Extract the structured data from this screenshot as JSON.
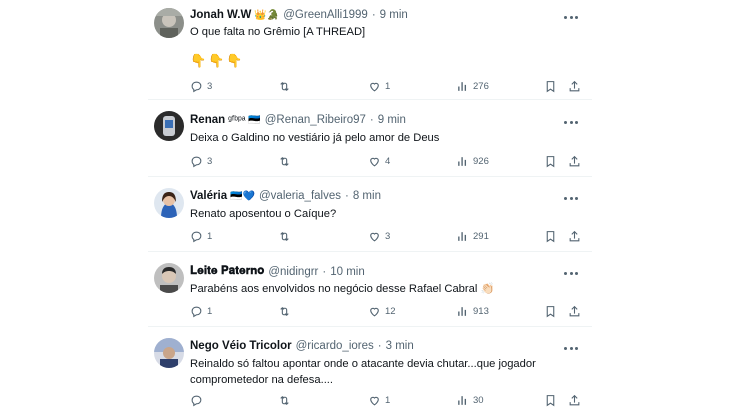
{
  "tweets": [
    {
      "name": "Jonah W.W",
      "badges": "👑🐊",
      "handle": "@GreenAlli1999",
      "time": "9 min",
      "text": "O que falta no Grêmio [A THREAD]",
      "extra": "👇👇👇",
      "replies": "3",
      "retweets": "",
      "likes": "1",
      "views": "276"
    },
    {
      "name": "Renan",
      "badges": "ᵍᶠᵇᵖᵃ 🇪🇪",
      "handle": "@Renan_Ribeiro97",
      "time": "9 min",
      "text": "Deixa o Galdino no vestiário já pelo amor de Deus",
      "replies": "3",
      "retweets": "",
      "likes": "4",
      "views": "926"
    },
    {
      "name": "Valéria",
      "badges": "🇪🇪💙",
      "handle": "@valeria_falves",
      "time": "8 min",
      "text": "Renato aposentou o Caíque?",
      "replies": "1",
      "retweets": "",
      "likes": "3",
      "views": "291"
    },
    {
      "name": "𝐋𝐞𝐢𝐭𝐞 𝐏𝐚𝐭𝐞𝐫𝐧𝐨",
      "badges": "",
      "handle": "@nidingrr",
      "time": "10 min",
      "text": "Parabéns aos envolvidos no negócio desse Rafael Cabral 👏🏻",
      "replies": "1",
      "retweets": "",
      "likes": "12",
      "views": "913"
    },
    {
      "name": "Nego Véio Tricolor",
      "badges": "",
      "handle": "@ricardo_iores",
      "time": "3 min",
      "text": "Reinaldo só faltou apontar onde o atacante devia chutar...que jogador comprometedor na defesa....",
      "replies": "",
      "retweets": "",
      "likes": "1",
      "views": "30"
    }
  ],
  "icons": {
    "reply": "reply-icon",
    "retweet": "retweet-icon",
    "like": "heart-icon",
    "views": "views-icon",
    "bookmark": "bookmark-icon",
    "share": "share-icon",
    "more": "more-icon"
  },
  "colors": {
    "text": "#0f1419",
    "secondary": "#536471",
    "divider": "#eff3f4"
  }
}
